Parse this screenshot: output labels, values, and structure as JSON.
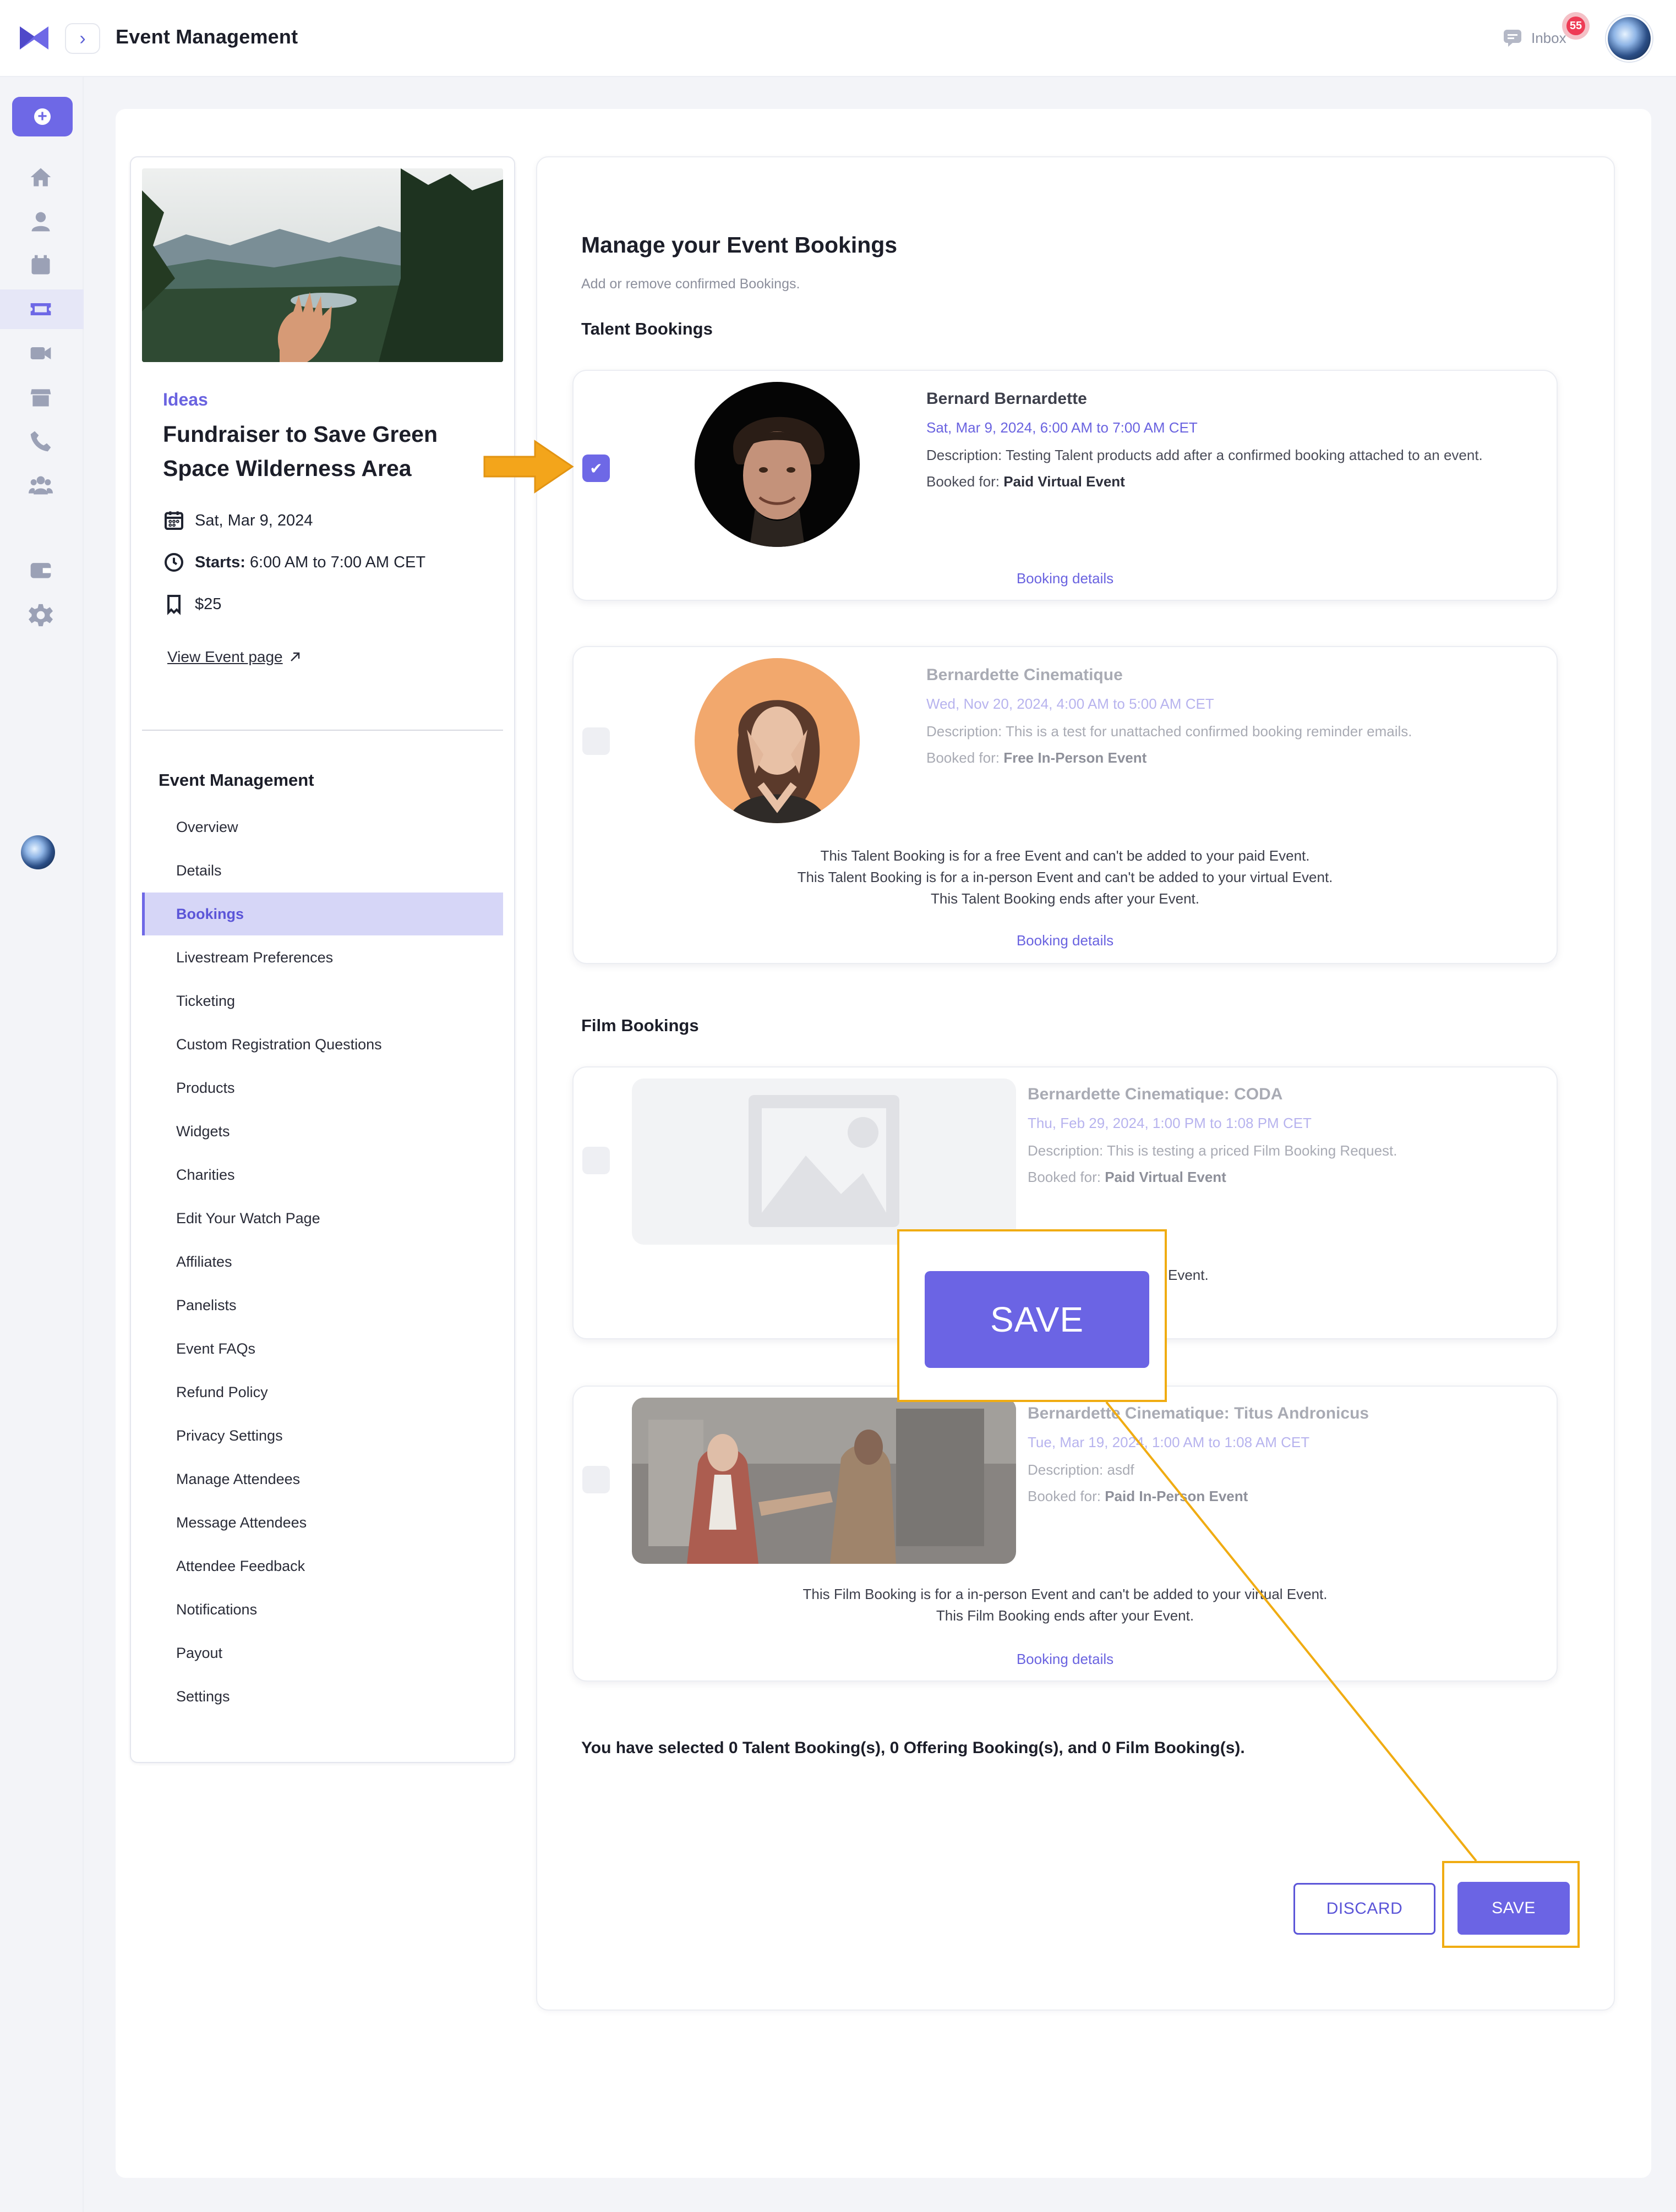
{
  "header": {
    "title": "Event Management",
    "inbox_label": "Inbox",
    "inbox_count": "55"
  },
  "event": {
    "category": "Ideas",
    "title": "Fundraiser to Save Green Space Wilderness Area",
    "date": "Sat, Mar 9, 2024",
    "starts_label": "Starts:",
    "time": "6:00 AM to 7:00 AM CET",
    "price": "$25",
    "view_link": "View Event page"
  },
  "nav": {
    "heading": "Event Management",
    "items": [
      "Overview",
      "Details",
      "Bookings",
      "Livestream Preferences",
      "Ticketing",
      "Custom Registration Questions",
      "Products",
      "Widgets",
      "Charities",
      "Edit Your Watch Page",
      "Affiliates",
      "Panelists",
      "Event FAQs",
      "Refund Policy",
      "Privacy Settings",
      "Manage Attendees",
      "Message Attendees",
      "Attendee Feedback",
      "Notifications",
      "Payout",
      "Settings"
    ],
    "active": "Bookings"
  },
  "main": {
    "heading": "Manage your Event Bookings",
    "subheading": "Add or remove confirmed Bookings.",
    "talent_title": "Talent Bookings",
    "film_title": "Film Bookings",
    "summary": "You have selected 0 Talent Booking(s), 0 Offering Booking(s), and 0 Film Booking(s).",
    "discard_label": "DISCARD",
    "save_label": "SAVE",
    "zoom_save_label": "SAVE"
  },
  "talent_bookings": [
    {
      "name": "Bernard Bernardette",
      "date": "Sat, Mar 9, 2024, 6:00 AM to 7:00 AM CET",
      "description": "Description: Testing Talent products add after a confirmed booking attached to an event.",
      "booked_for_label": "Booked for:",
      "booked_for": "Paid Virtual Event",
      "link": "Booking details",
      "checked": true
    },
    {
      "name": "Bernardette Cinematique",
      "date": "Wed, Nov 20, 2024, 4:00 AM to 5:00 AM CET",
      "description": "Description: This is a test for unattached confirmed booking reminder emails.",
      "booked_for_label": "Booked for:",
      "booked_for": "Free In-Person Event",
      "notes": [
        "This Talent Booking is for a free Event and can't be added to your paid Event.",
        "This Talent Booking is for a in-person Event and can't be added to your virtual Event.",
        "This Talent Booking ends after your Event."
      ],
      "link": "Booking details",
      "checked": false
    }
  ],
  "film_bookings": [
    {
      "name": "Bernardette Cinematique: CODA",
      "date": "Thu, Feb 29, 2024, 1:00 PM to 1:08 PM CET",
      "description": "Description: This is testing a priced Film Booking Request.",
      "booked_for_label": "Booked for:",
      "booked_for": "Paid Virtual Event",
      "notes_visible_fragment": "Event.",
      "checked": false
    },
    {
      "name": "Bernardette Cinematique: Titus Andronicus",
      "date": "Tue, Mar 19, 2024, 1:00 AM to 1:08 AM CET",
      "description": "Description: asdf",
      "booked_for_label": "Booked for:",
      "booked_for": "Paid In-Person Event",
      "notes": [
        "This Film Booking is for a in-person Event and can't be added to your virtual Event.",
        "This Film Booking ends after your Event."
      ],
      "link": "Booking details",
      "checked": false
    }
  ],
  "colors": {
    "accent": "#6e68e6",
    "callout": "#f0ac12"
  },
  "icons": [
    "logo-icon",
    "chevron-right-icon",
    "chat-icon",
    "plus-icon",
    "home-icon",
    "person-icon",
    "calendar-icon",
    "ticket-icon",
    "video-icon",
    "store-icon",
    "phone-icon",
    "group-icon",
    "wallet-icon",
    "gear-icon",
    "clock-icon",
    "bookmark-icon",
    "external-link-icon",
    "check-icon",
    "image-placeholder-icon",
    "arrow-right-icon"
  ]
}
